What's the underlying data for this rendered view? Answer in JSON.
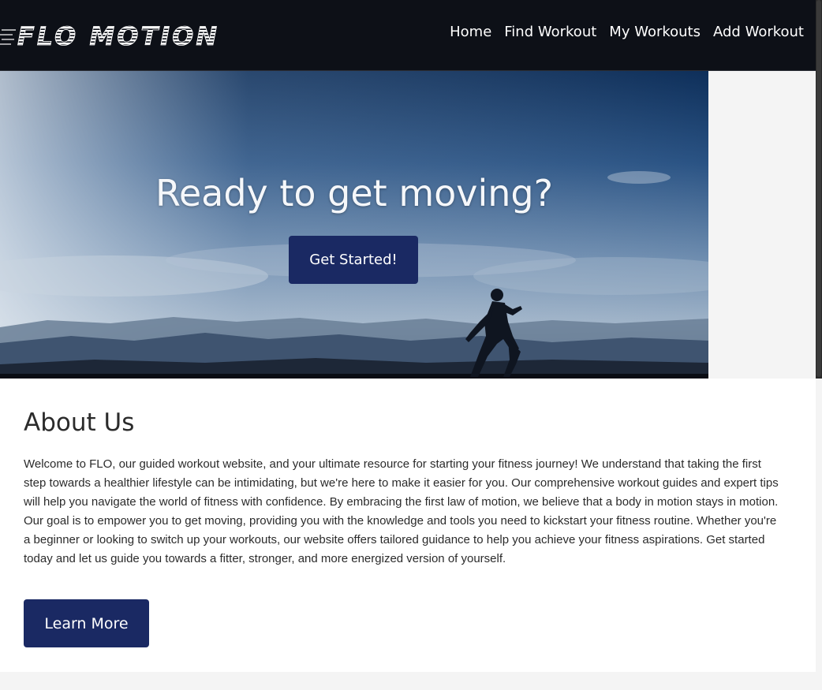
{
  "brand": {
    "logo_text": "FLO MOTION"
  },
  "nav": {
    "items": [
      "Home",
      "Find Workout",
      "My Workouts",
      "Add Workout"
    ]
  },
  "hero": {
    "title": "Ready to get moving?",
    "cta_label": "Get Started!"
  },
  "about": {
    "heading": "About Us",
    "body": "Welcome to FLO, our guided workout website, and your ultimate resource for starting your fitness journey! We understand that taking the first step towards a healthier lifestyle can be intimidating, but we're here to make it easier for you. Our comprehensive workout guides and expert tips will help you navigate the world of fitness with confidence. By embracing the first law of motion, we believe that a body in motion stays in motion. Our goal is to empower you to get moving, providing you with the knowledge and tools you need to kickstart your fitness routine. Whether you're a beginner or looking to switch up your workouts, our website offers tailored guidance to help you achieve your fitness aspirations. Get started today and let us guide you towards a fitter, stronger, and more energized version of yourself.",
    "button_label": "Learn More"
  },
  "colors": {
    "header_bg": "#0d1017",
    "accent": "#1a2963",
    "page_bg": "#f4f4f4"
  }
}
